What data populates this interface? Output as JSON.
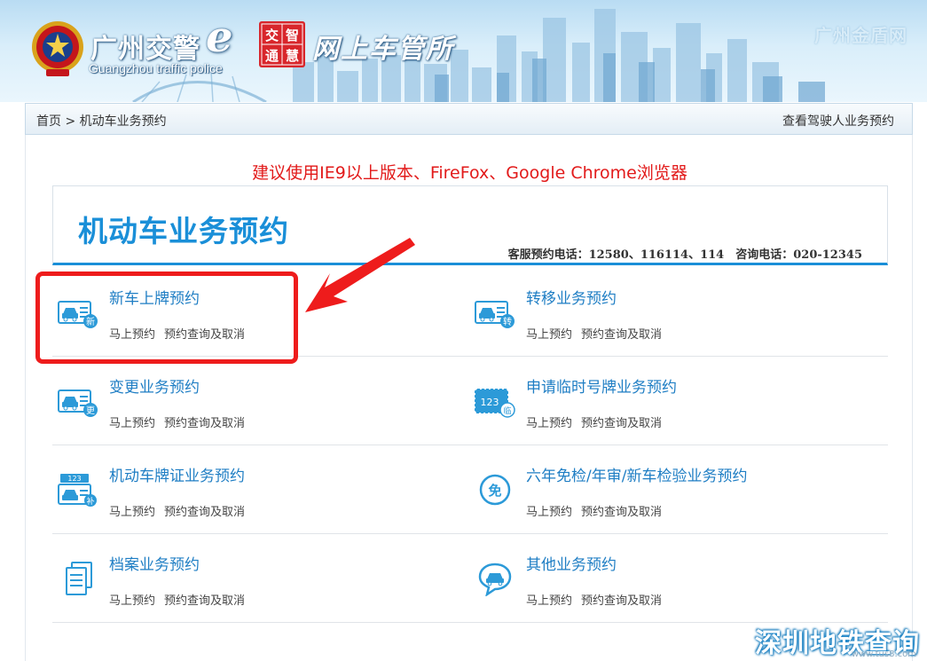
{
  "header": {
    "brand_title": "广州交警",
    "brand_e": "e",
    "brand_subtitle": "Guangzhou traffic police",
    "seal_chars": [
      "交",
      "智",
      "通",
      "慧"
    ],
    "office_title": "网上车管所",
    "shield_label": "广州金盾网"
  },
  "breadcrumb": {
    "home": "首页",
    "separator": " > ",
    "current": "机动车业务预约",
    "driver_link": "查看驾驶人业务预约"
  },
  "notice": "建议使用IE9以上版本、FireFox、Google Chrome浏览器",
  "panel": {
    "title": "机动车业务预约",
    "hotline": "客服预约电话：12580、116114、114　咨询电话：020-12345"
  },
  "services": [
    {
      "title": "新车上牌预约",
      "icon": "new-car-icon",
      "badge": "新",
      "book": "马上预约",
      "query": "预约查询及取消"
    },
    {
      "title": "转移业务预约",
      "icon": "transfer-car-icon",
      "badge": "转",
      "book": "马上预约",
      "query": "预约查询及取消"
    },
    {
      "title": "变更业务预约",
      "icon": "change-car-icon",
      "badge": "更",
      "book": "马上预约",
      "query": "预约查询及取消"
    },
    {
      "title": "申请临时号牌业务预约",
      "icon": "temp-plate-icon",
      "badge": "临",
      "plate_number": "123",
      "book": "马上预约",
      "query": "预约查询及取消"
    },
    {
      "title": "机动车牌证业务预约",
      "icon": "plate-certificate-icon",
      "badge": "补",
      "plate_number": "123",
      "book": "马上预约",
      "query": "预约查询及取消"
    },
    {
      "title": "六年免检/年审/新车检验业务预约",
      "icon": "exemption-icon",
      "badge": "免",
      "book": "马上预约",
      "query": "预约查询及取消"
    },
    {
      "title": "档案业务预约",
      "icon": "archive-icon",
      "book": "马上预约",
      "query": "预约查询及取消"
    },
    {
      "title": "其他业务预约",
      "icon": "other-service-icon",
      "book": "马上预约",
      "query": "预约查询及取消"
    }
  ],
  "watermark": {
    "text": "深圳地铁查询",
    "url": "www.tus8.com"
  },
  "colors": {
    "accent": "#1a8fd8",
    "link": "#1f7ec4",
    "notice": "#e21a1a",
    "highlight": "#ee1c1c"
  }
}
